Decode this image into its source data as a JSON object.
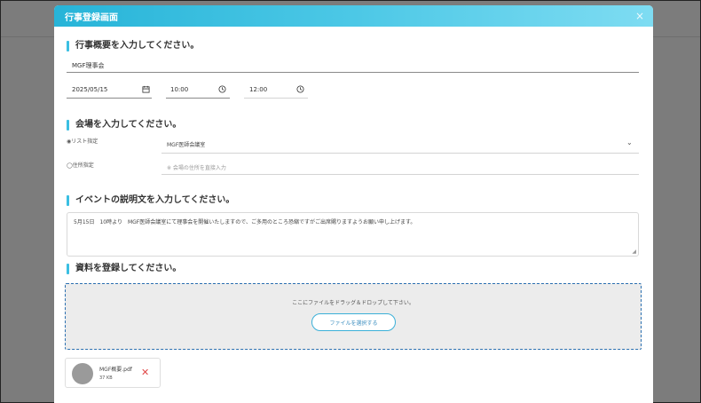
{
  "modal": {
    "title": "行事登録画面",
    "close": "×"
  },
  "overview": {
    "heading": "行事概要を入力してください。",
    "name_value": "MGF理事会",
    "date_value": "2025/05/15",
    "start_time": "10:00",
    "end_time": "12:00"
  },
  "venue": {
    "heading": "会場を入力してください。",
    "list_option": "◉リスト指定",
    "list_value": "MGF医師会議室",
    "address_option": "◯住所指定",
    "address_placeholder": "※ 会場の住所を直接入力"
  },
  "description": {
    "heading": "イベントの説明文を入力してください。",
    "text": "5月15日　10時より　MGF医師会議室にて理事会を開催いたしますので、ご多用のところ恐縮ですがご出席賜りますようお願い申し上げます。"
  },
  "materials": {
    "heading": "資料を登録してください。",
    "drop_text": "ここにファイルをドラッグ＆ドロップして下さい。",
    "select_button": "ファイルを選択する"
  },
  "file": {
    "name": "MGF概要.pdf",
    "size": "37 KB"
  },
  "colors": {
    "header_start": "#27b4d8",
    "header_end": "#7edcf2",
    "accent_bar": "#3bbfe2",
    "dropzone_border": "#2a6fb0",
    "remove": "#e04848"
  }
}
